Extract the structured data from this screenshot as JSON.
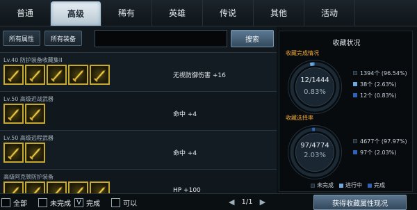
{
  "tabs": [
    {
      "label": "普通",
      "active": false
    },
    {
      "label": "高级",
      "active": true
    },
    {
      "label": "稀有",
      "active": false
    },
    {
      "label": "英雄",
      "active": false
    },
    {
      "label": "传说",
      "active": false
    },
    {
      "label": "其他",
      "active": false
    },
    {
      "label": "活动",
      "active": false
    }
  ],
  "filters": {
    "all_attributes": "所有属性",
    "all_equipment": "所有装备"
  },
  "search": {
    "value": "",
    "button": "搜索"
  },
  "rows": [
    {
      "title": "Lv.40 防护装备收藏集II",
      "icon_count": 5,
      "stat": "无视防御伤害 +16"
    },
    {
      "title": "Lv.50 高级近战武器",
      "icon_count": 2,
      "stat": "命中 +4"
    },
    {
      "title": "Lv.50 高级远程武器",
      "icon_count": 2,
      "stat": "命中 +4"
    },
    {
      "title": "高级阿克顿防护装备",
      "icon_count": 5,
      "stat": "HP +100"
    }
  ],
  "panel": {
    "title": "收藏状况",
    "completion": {
      "label": "收藏完成情况",
      "center_count": "12/1444",
      "center_pct": "0.83%",
      "legend": [
        "1394个 (96.54%)",
        "38个 (2.63%)",
        "12个 (0.83%)"
      ],
      "fractions": [
        0.9654,
        0.0263,
        0.0083
      ]
    },
    "selection": {
      "label": "收藏选择率",
      "center_count": "97/4774",
      "center_pct": "2.03%",
      "legend": [
        "4677个 (97.97%)",
        "97个 (2.03%)"
      ],
      "fractions": [
        0.9797,
        0.0203
      ]
    },
    "bottom_legend": [
      "未完成",
      "进行中",
      "完成"
    ],
    "colors": {
      "incomplete": "#1c2a36",
      "in_progress": "#6fa8dc",
      "complete": "#2f63b8"
    }
  },
  "bottom": {
    "checks": [
      {
        "label": "全部",
        "checked": false
      },
      {
        "label": "未完成",
        "checked": false
      },
      {
        "label": "完成",
        "checked": true,
        "mark": "V"
      },
      {
        "label": "可以",
        "checked": false
      }
    ],
    "page": "1/1",
    "prev": "◀",
    "next": "▶",
    "apply": "获得收藏属性现况"
  }
}
